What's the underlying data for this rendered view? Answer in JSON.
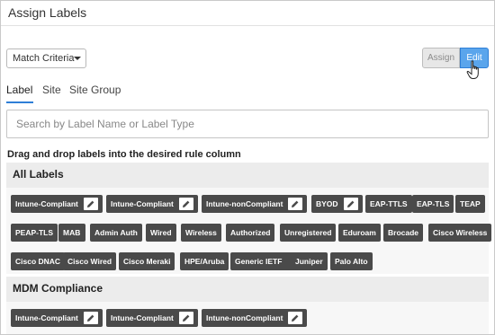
{
  "header": {
    "title": "Assign Labels"
  },
  "toolbar": {
    "match_criteria": "Match Criteria",
    "assign_label": "Assign",
    "edit_label": "Edit"
  },
  "tabs": [
    {
      "label": "Label",
      "active": true
    },
    {
      "label": "Site",
      "active": false
    },
    {
      "label": "Site Group",
      "active": false
    }
  ],
  "search": {
    "placeholder": "Search by Label Name or Label Type"
  },
  "instruction": "Drag and drop labels into the desired rule column",
  "sections": [
    {
      "title": "All Labels",
      "labels": [
        {
          "text": "Intune-Compliant",
          "editable": true
        },
        {
          "text": "Intune-Compliant",
          "editable": true
        },
        {
          "text": "Intune-nonCompliant",
          "editable": true
        },
        {
          "text": "BYOD",
          "editable": true
        },
        {
          "text": "EAP-TTLS",
          "editable": false
        },
        {
          "text": "EAP-TLS",
          "editable": false
        },
        {
          "text": "TEAP",
          "editable": false
        },
        {
          "text": "PEAP-TLS",
          "editable": false
        },
        {
          "text": "MAB",
          "editable": false
        },
        {
          "text": "Admin Auth",
          "editable": false
        },
        {
          "text": "Wired",
          "editable": false
        },
        {
          "text": "Wireless",
          "editable": false
        },
        {
          "text": "Authorized",
          "editable": false
        },
        {
          "text": "Unregistered",
          "editable": false
        },
        {
          "text": "Eduroam",
          "editable": false
        },
        {
          "text": "Brocade",
          "editable": false
        },
        {
          "text": "Cisco Wireless",
          "editable": false
        },
        {
          "text": "Cisco DNAC",
          "editable": false
        },
        {
          "text": "Cisco Wired",
          "editable": false
        },
        {
          "text": "Cisco Meraki",
          "editable": false
        },
        {
          "text": "HPE/Aruba",
          "editable": false
        },
        {
          "text": "Generic IETF",
          "editable": false
        },
        {
          "text": "Juniper",
          "editable": false
        },
        {
          "text": "Palo Alto",
          "editable": false
        }
      ]
    },
    {
      "title": "MDM Compliance",
      "labels": [
        {
          "text": "Intune-Compliant",
          "editable": true
        },
        {
          "text": "Intune-Compliant",
          "editable": true
        },
        {
          "text": "Intune-nonCompliant",
          "editable": true
        }
      ]
    }
  ],
  "colors": {
    "accent": "#2f7fd7",
    "chip_bg": "#4a4a4a",
    "section_bg": "#ececec",
    "edit_button": "#5aa5ec"
  },
  "icons": {
    "chip_edit": "pencil-icon",
    "dropdown": "caret-down-icon",
    "pointer": "hand-pointer-icon"
  }
}
